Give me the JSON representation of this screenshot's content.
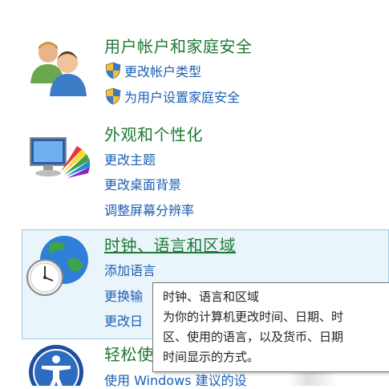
{
  "categories": [
    {
      "icon": "users-icon",
      "title": "用户帐户和家庭安全",
      "links": [
        "更改帐户类型",
        "为用户设置家庭安全"
      ]
    },
    {
      "icon": "appearance-icon",
      "title": "外观和个性化",
      "links": [
        "更改主题",
        "更改桌面背景",
        "调整屏幕分辨率"
      ]
    },
    {
      "icon": "clock-globe-icon",
      "title": "时钟、语言和区域",
      "links": [
        "添加语言",
        "更换输",
        "更改日"
      ]
    },
    {
      "icon": "ease-of-access-icon",
      "title": "轻松使",
      "links": [
        "使用 Windows 建议的设"
      ]
    }
  ],
  "tooltip": {
    "title": "时钟、语言和区域",
    "lines": [
      "为你的计算机更改时间、日期、时",
      "区、使用的语言，以及货币、日期",
      "时间显示的方式。"
    ]
  },
  "colors": {
    "title_green": "#1e7a35",
    "link_blue": "#1a5fb4",
    "hover_bg": "#e9f4fb",
    "hover_border": "#9ecbe6"
  }
}
